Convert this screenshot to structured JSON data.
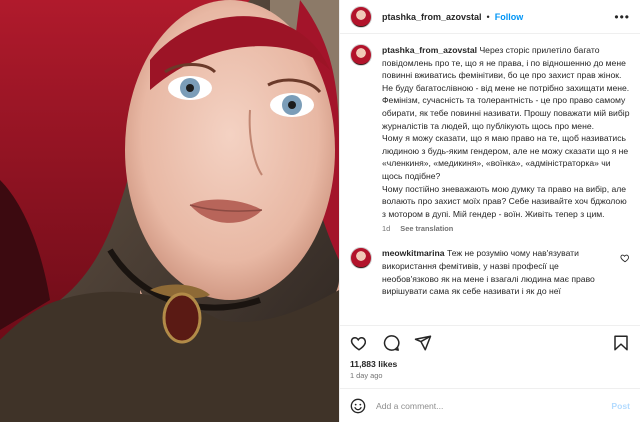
{
  "post": {
    "username": "ptashka_from_azovstal",
    "follow_label": "Follow",
    "separator": "•",
    "more_label": "•••"
  },
  "caption": {
    "username": "ptashka_from_azovstal",
    "text": "Через сторіс прилетіло багато повідомлень про те, що я не права, і по відношенню до мене повинні вживатись фемінітиви, бо це про захист прав жінок. Не буду багатослівною - від мене не потрібно захищати мене. Фемінізм, сучасність та толерантність - це про право самому обирати, як тебе повинні називати. Прошу поважати мій вибір журналістів та людей, що публікують щось про мене.\nЧому я можу сказати, що я маю право на те, щоб називатись людиною з будь-яким гендером, але не можу сказати що я не «членкиня», «медикиня», «воїнка», «адміністраторка» чи щось подібне?\nЧому постійно зневажають мою думку та право на вибір, але волають про захист моїх прав? Себе називайте хоч бджолою з мотором в дупі. Мій гендер - воїн. Живіть тепер з цим.",
    "age": "1d",
    "see_translation": "See translation"
  },
  "comment": {
    "username": "meowkitmarina",
    "text": "Теж не розумію чому нав'язувати використання фемітивів, у назві професії це необов'язково як на мене і взагалі людина має право вирішувати сама як себе називати і як до неї"
  },
  "stats": {
    "likes": "11,883 likes",
    "time_ago": "1 day ago"
  },
  "compose": {
    "placeholder": "Add a comment...",
    "post_label": "Post"
  },
  "colors": {
    "accent": "#0095f6",
    "post_disabled": "#b3dbff",
    "muted": "#737373"
  },
  "icons": [
    "heart-icon",
    "comment-icon",
    "share-icon",
    "bookmark-icon",
    "emoji-icon",
    "more-icon"
  ]
}
